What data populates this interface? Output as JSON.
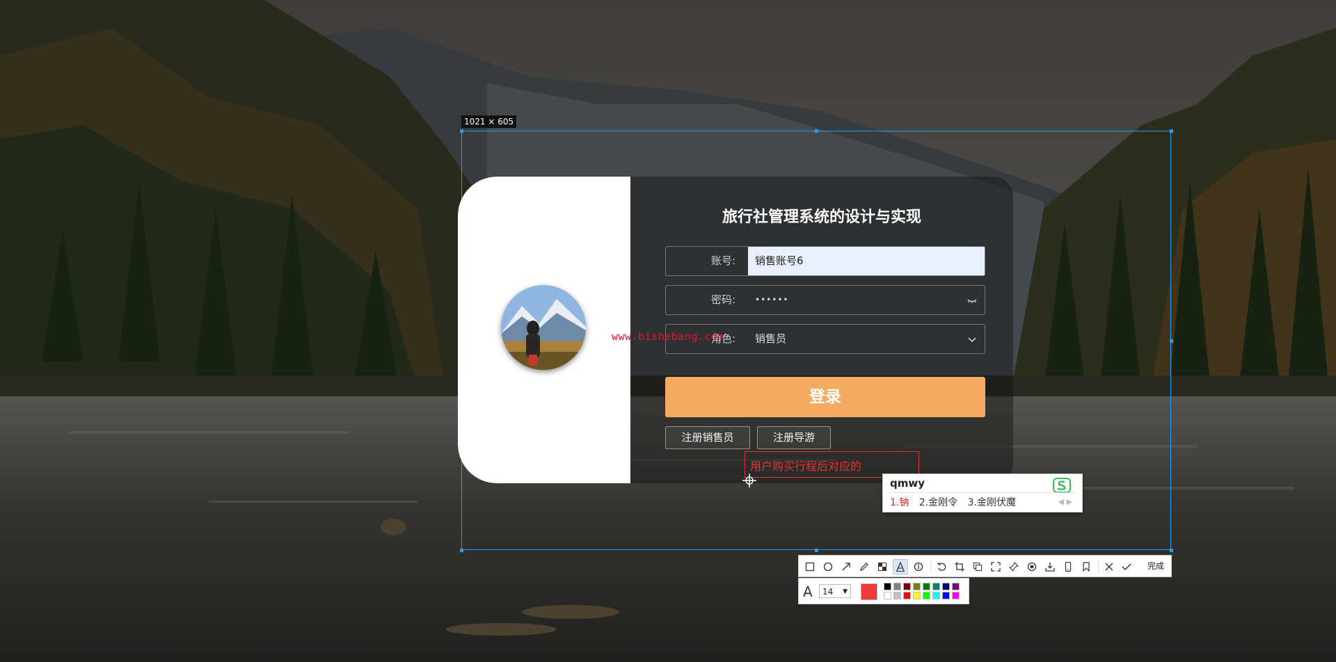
{
  "selection": {
    "size_label": "1021 × 605"
  },
  "login": {
    "title": "旅行社管理系统的设计与实现",
    "account_label": "账号:",
    "account_value": "销售账号6",
    "password_label": "密码:",
    "password_value": "••••••",
    "role_label": "角色:",
    "role_value": "销售员",
    "login_button": "登录",
    "register_sales_button": "注册销售员",
    "register_guide_button": "注册导游",
    "watermark": "www.bishebang.com"
  },
  "annotation": {
    "text": "用户购买行程后对应的"
  },
  "ime": {
    "input": "qmwy",
    "candidates": [
      "1.钠",
      "2.金刚令",
      "3.金刚伏魔"
    ]
  },
  "toolbar": {
    "icons": [
      "rectangle-icon",
      "ellipse-icon",
      "arrow-icon",
      "pen-icon",
      "mosaic-icon",
      "text-icon",
      "serial-number-icon",
      "undo-icon",
      "crop-icon",
      "copy-icon",
      "fullscreen-icon",
      "pin-icon",
      "record-icon",
      "download-icon",
      "phone-icon",
      "bookmark-icon",
      "close-icon",
      "check-icon"
    ],
    "done_label": "完成",
    "font_size": "14",
    "current_color": "#ef3a3a",
    "palette_top": [
      "#000000",
      "#808080",
      "#800000",
      "#808000",
      "#008000",
      "#008080",
      "#000080",
      "#800080"
    ],
    "palette_bottom": [
      "#ffffff",
      "#c0c0c0",
      "#ff0000",
      "#ffff00",
      "#00ff00",
      "#00ffff",
      "#0000ff",
      "#ff00ff"
    ]
  }
}
